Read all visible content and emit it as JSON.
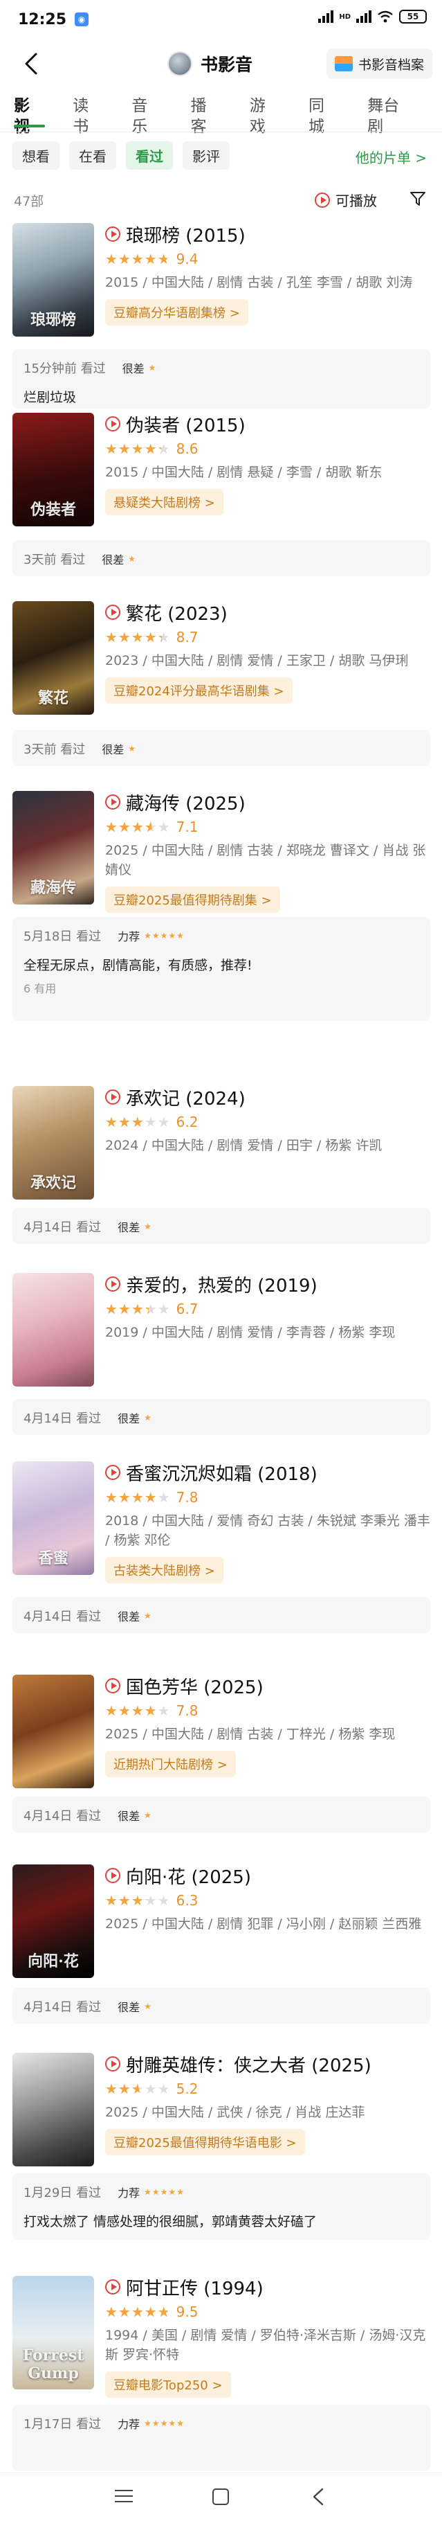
{
  "status_bar": {
    "time": "12:25",
    "battery": "55"
  },
  "header": {
    "username": "书影音",
    "archive_label": "书影音档案"
  },
  "category_tabs": [
    {
      "label": "影视",
      "active": true
    },
    {
      "label": "读书",
      "active": false
    },
    {
      "label": "音乐",
      "active": false
    },
    {
      "label": "播客",
      "active": false
    },
    {
      "label": "游戏",
      "active": false
    },
    {
      "label": "同城",
      "active": false
    },
    {
      "label": "舞台剧",
      "active": false
    }
  ],
  "state_tabs": [
    {
      "label": "想看",
      "active": false
    },
    {
      "label": "在看",
      "active": false
    },
    {
      "label": "看过",
      "active": true
    },
    {
      "label": "影评",
      "active": false
    }
  ],
  "playlist_link": "他的片单 >",
  "count_label": "47部",
  "playable_label": "可播放",
  "items": [
    {
      "title": "琅琊榜 (2015)",
      "rating": 9.4,
      "score": "9.4",
      "meta": "2015 / 中国大陆 / 剧情 古装 / 孔笙 李雪 / 胡歌 刘涛",
      "chart": "豆瓣高分华语剧集榜 >",
      "date": "15分钟前 看过",
      "verdict": "很差",
      "review": "烂剧垃圾",
      "helpful": "",
      "poster_text": "琅琊榜"
    },
    {
      "title": "伪装者 (2015)",
      "rating": 8.6,
      "score": "8.6",
      "meta": "2015 / 中国大陆 / 剧情 悬疑 / 李雪 / 胡歌 靳东",
      "chart": "悬疑类大陆剧榜 >",
      "date": "3天前 看过",
      "verdict": "很差",
      "review": "",
      "helpful": "",
      "poster_text": "伪装者"
    },
    {
      "title": "繁花 (2023)",
      "rating": 8.7,
      "score": "8.7",
      "meta": "2023 / 中国大陆 / 剧情 爱情 / 王家卫 / 胡歌 马伊琍",
      "chart": "豆瓣2024评分最高华语剧集 >",
      "date": "3天前 看过",
      "verdict": "很差",
      "review": "",
      "helpful": "",
      "poster_text": "繁花"
    },
    {
      "title": "藏海传 (2025)",
      "rating": 7.1,
      "score": "7.1",
      "meta": "2025 / 中国大陆 / 剧情 古装 / 郑晓龙 曹译文 / 肖战 张婧仪",
      "chart": "豆瓣2025最值得期待剧集 >",
      "date": "5月18日 看过",
      "verdict": "力荐",
      "review": "全程无尿点，剧情高能，有质感，推荐!",
      "helpful": "6 有用",
      "poster_text": "藏海传"
    },
    {
      "title": "承欢记 (2024)",
      "rating": 6.2,
      "score": "6.2",
      "meta": "2024 / 中国大陆 / 剧情 爱情 / 田宇 / 杨紫 许凯",
      "chart": "",
      "date": "4月14日 看过",
      "verdict": "很差",
      "review": "",
      "helpful": "",
      "poster_text": "承欢记"
    },
    {
      "title": "亲爱的，热爱的 (2019)",
      "rating": 6.7,
      "score": "6.7",
      "meta": "2019 / 中国大陆 / 剧情 爱情 / 李青蓉 / 杨紫 李现",
      "chart": "",
      "date": "4月14日 看过",
      "verdict": "很差",
      "review": "",
      "helpful": "",
      "poster_text": ""
    },
    {
      "title": "香蜜沉沉烬如霜 (2018)",
      "rating": 7.8,
      "score": "7.8",
      "meta": "2018 / 中国大陆 / 爱情 奇幻 古装 / 朱锐斌 李秉光 潘丰 / 杨紫 邓伦",
      "chart": "古装类大陆剧榜 >",
      "date": "4月14日 看过",
      "verdict": "很差",
      "review": "",
      "helpful": "",
      "poster_text": "香蜜"
    },
    {
      "title": "国色芳华 (2025)",
      "rating": 7.8,
      "score": "7.8",
      "meta": "2025 / 中国大陆 / 剧情 古装 / 丁梓光 / 杨紫 李现",
      "chart": "近期热门大陆剧榜 >",
      "date": "4月14日 看过",
      "verdict": "很差",
      "review": "",
      "helpful": "",
      "poster_text": ""
    },
    {
      "title": "向阳·花 (2025)",
      "rating": 6.3,
      "score": "6.3",
      "meta": "2025 / 中国大陆 / 剧情 犯罪 / 冯小刚 / 赵丽颖 兰西雅",
      "chart": "",
      "date": "4月14日 看过",
      "verdict": "很差",
      "review": "",
      "helpful": "",
      "poster_text": "向阳·花"
    },
    {
      "title": "射雕英雄传：侠之大者 (2025)",
      "rating": 5.2,
      "score": "5.2",
      "meta": "2025 / 中国大陆 / 武侠 / 徐克 / 肖战 庄达菲",
      "chart": "豆瓣2025最值得期待华语电影 >",
      "date": "1月29日 看过",
      "verdict": "力荐",
      "review": "打戏太燃了 情感处理的很细腻，郭靖黄蓉太好磕了",
      "helpful": "",
      "poster_text": ""
    },
    {
      "title": "阿甘正传 (1994)",
      "rating": 9.5,
      "score": "9.5",
      "meta": "1994 / 美国 / 剧情 爱情 / 罗伯特·泽米吉斯 / 汤姆·汉克斯 罗宾·怀特",
      "chart": "豆瓣电影Top250 >",
      "date": "1月17日 看过",
      "verdict": "力荐",
      "review": "",
      "helpful": "",
      "poster_text": "Forrest Gump"
    }
  ]
}
